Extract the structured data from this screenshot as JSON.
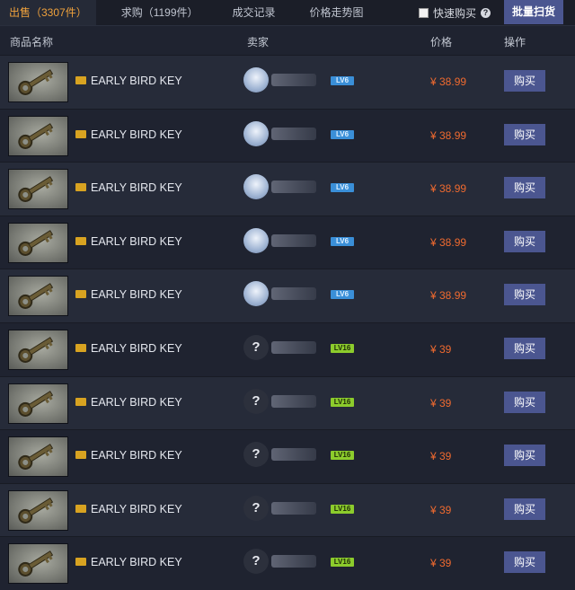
{
  "tabs": [
    {
      "label": "出售（3307件）",
      "active": true
    },
    {
      "label": "求购（1199件）",
      "active": false
    },
    {
      "label": "成交记录",
      "active": false
    },
    {
      "label": "价格走势图",
      "active": false
    }
  ],
  "quick_buy_label": "快速购买",
  "bulk_button": "批量扫货",
  "columns": {
    "item": "商品名称",
    "seller": "卖家",
    "price": "价格",
    "action": "操作"
  },
  "rows": [
    {
      "name": "EARLY BIRD KEY",
      "level": "LV6",
      "level_color": "blue",
      "avatar": "anime",
      "price": "¥ 38.99",
      "buy": "购买"
    },
    {
      "name": "EARLY BIRD KEY",
      "level": "LV6",
      "level_color": "blue",
      "avatar": "anime",
      "price": "¥ 38.99",
      "buy": "购买"
    },
    {
      "name": "EARLY BIRD KEY",
      "level": "LV6",
      "level_color": "blue",
      "avatar": "anime",
      "price": "¥ 38.99",
      "buy": "购买"
    },
    {
      "name": "EARLY BIRD KEY",
      "level": "LV6",
      "level_color": "blue",
      "avatar": "anime",
      "price": "¥ 38.99",
      "buy": "购买"
    },
    {
      "name": "EARLY BIRD KEY",
      "level": "LV6",
      "level_color": "blue",
      "avatar": "anime",
      "price": "¥ 38.99",
      "buy": "购买"
    },
    {
      "name": "EARLY BIRD KEY",
      "level": "LV16",
      "level_color": "green",
      "avatar": "question",
      "price": "¥ 39",
      "buy": "购买"
    },
    {
      "name": "EARLY BIRD KEY",
      "level": "LV16",
      "level_color": "green",
      "avatar": "question",
      "price": "¥ 39",
      "buy": "购买"
    },
    {
      "name": "EARLY BIRD KEY",
      "level": "LV16",
      "level_color": "green",
      "avatar": "question",
      "price": "¥ 39",
      "buy": "购买"
    },
    {
      "name": "EARLY BIRD KEY",
      "level": "LV16",
      "level_color": "green",
      "avatar": "question",
      "price": "¥ 39",
      "buy": "购买"
    },
    {
      "name": "EARLY BIRD KEY",
      "level": "LV16",
      "level_color": "green",
      "avatar": "question",
      "price": "¥ 39",
      "buy": "购买"
    }
  ],
  "question_glyph": "?",
  "colors": {
    "accent": "#f0a23c",
    "price": "#ef6a2f",
    "button": "#4b5690",
    "level_blue": "#3a8fd8",
    "level_green": "#8ccc2c"
  }
}
